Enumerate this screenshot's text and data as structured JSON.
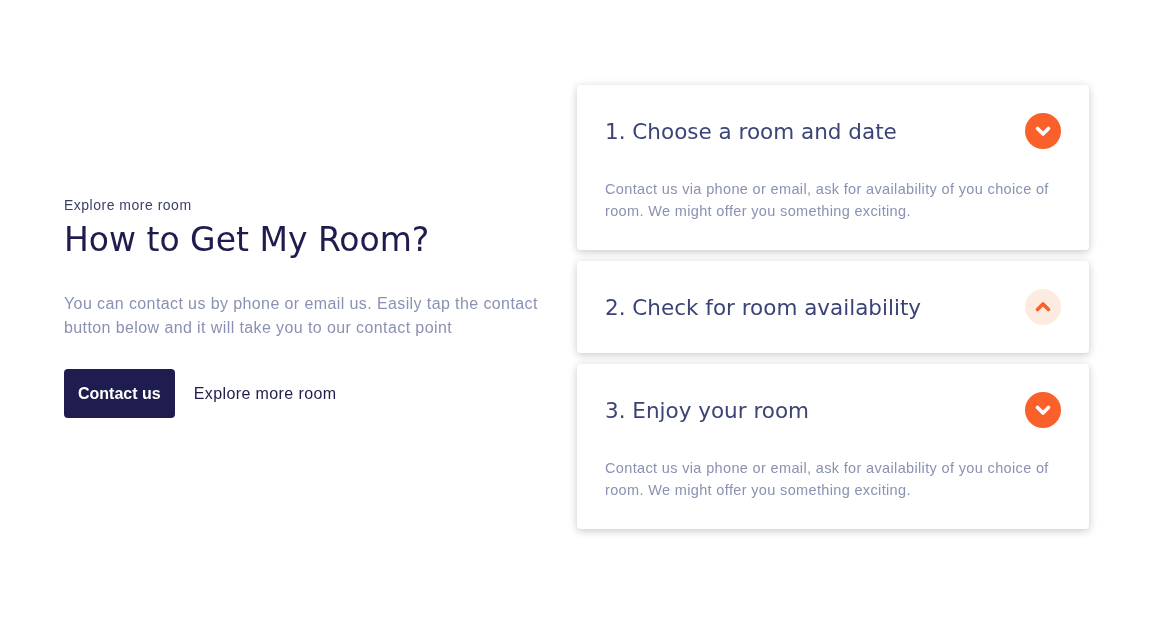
{
  "intro": {
    "eyebrow": "Explore more room",
    "heading": "How to Get My Room?",
    "description": "You can contact us by phone or email us. Easily tap the contact button below and it will take you to our contact point",
    "buttons": [
      {
        "label": "Contact us",
        "kind": "primary"
      },
      {
        "label": "Explore more room",
        "kind": "link"
      }
    ]
  },
  "steps": [
    {
      "title": "1. Choose a room and date",
      "expanded": true,
      "body": "Contact us via phone or email, ask for availability of you choice of room. We might offer you something exciting."
    },
    {
      "title": "2. Check for room availability",
      "expanded": false
    },
    {
      "title": "3. Enjoy your room",
      "expanded": true,
      "body": "Contact us via phone or email, ask for availability of you choice of room. We might offer you something exciting."
    }
  ]
}
